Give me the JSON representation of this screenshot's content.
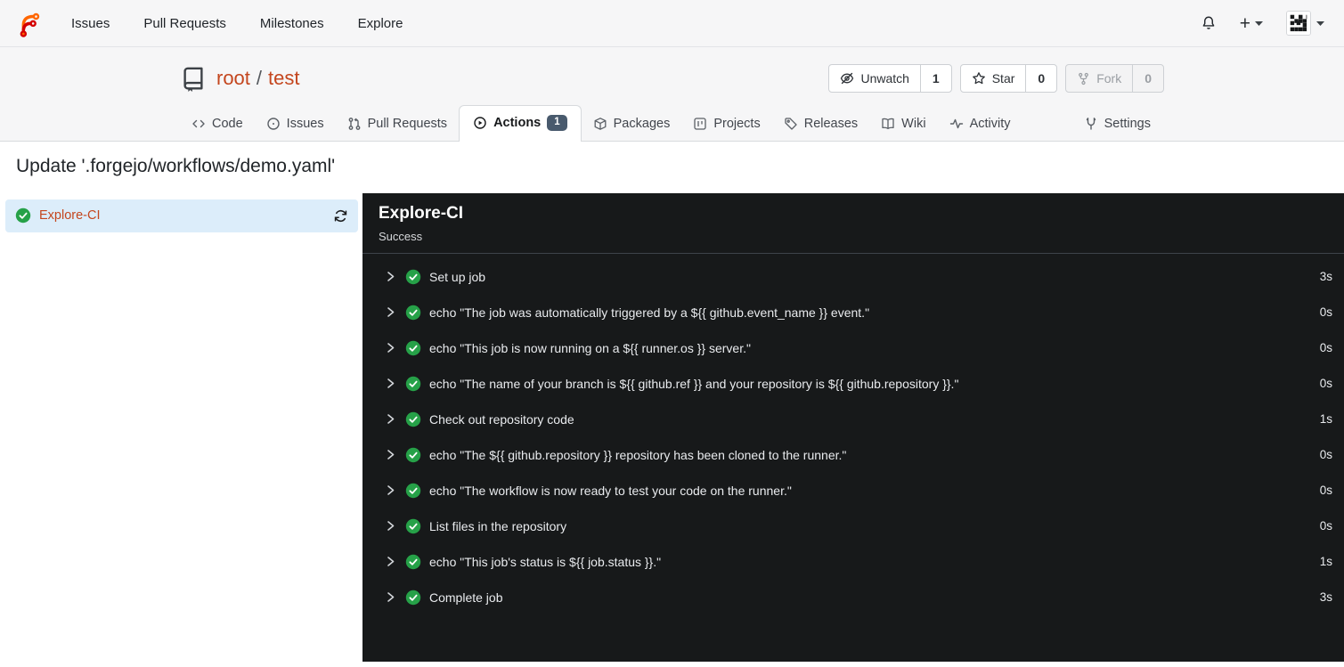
{
  "navbar": {
    "items": [
      {
        "label": "Issues"
      },
      {
        "label": "Pull Requests"
      },
      {
        "label": "Milestones"
      },
      {
        "label": "Explore"
      }
    ],
    "create_label": "+"
  },
  "repo": {
    "owner": "root",
    "separator": "/",
    "name": "test",
    "watch": {
      "label": "Unwatch",
      "count": "1"
    },
    "star": {
      "label": "Star",
      "count": "0"
    },
    "fork": {
      "label": "Fork",
      "count": "0"
    }
  },
  "tabs": {
    "code": "Code",
    "issues": "Issues",
    "pulls": "Pull Requests",
    "actions": "Actions",
    "actions_badge": "1",
    "packages": "Packages",
    "projects": "Projects",
    "releases": "Releases",
    "wiki": "Wiki",
    "activity": "Activity",
    "settings": "Settings"
  },
  "run": {
    "title": "Update '.forgejo/workflows/demo.yaml'",
    "job_name": "Explore-CI"
  },
  "panel": {
    "title": "Explore-CI",
    "status": "Success",
    "steps": [
      {
        "name": "Set up job",
        "duration": "3s"
      },
      {
        "name": "echo \"The job was automatically triggered by a ${{ github.event_name }} event.\"",
        "duration": "0s"
      },
      {
        "name": "echo \"This job is now running on a ${{ runner.os }} server.\"",
        "duration": "0s"
      },
      {
        "name": "echo \"The name of your branch is ${{ github.ref }} and your repository is ${{ github.repository }}.\"",
        "duration": "0s"
      },
      {
        "name": "Check out repository code",
        "duration": "1s"
      },
      {
        "name": "echo \"The ${{ github.repository }} repository has been cloned to the runner.\"",
        "duration": "0s"
      },
      {
        "name": "echo \"The workflow is now ready to test your code on the runner.\"",
        "duration": "0s"
      },
      {
        "name": "List files in the repository",
        "duration": "0s"
      },
      {
        "name": "echo \"This job's status is ${{ job.status }}.\"",
        "duration": "1s"
      },
      {
        "name": "Complete job",
        "duration": "3s"
      }
    ]
  },
  "colors": {
    "accent_link": "#c4461e",
    "success_green": "#26a148",
    "panel_bg": "#17191a",
    "selected_row_bg": "#dcedfa",
    "badge_bg": "#495a6d",
    "header_bg": "#f6f6f7"
  }
}
